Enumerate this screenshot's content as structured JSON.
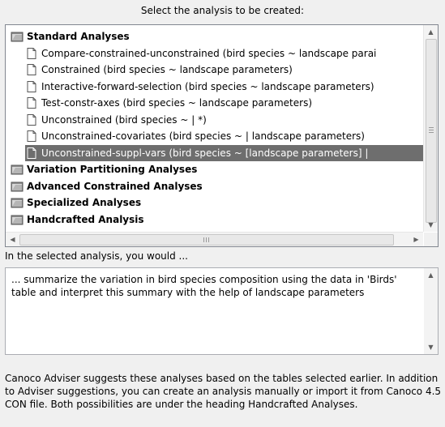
{
  "prompt": "Select the analysis to be created:",
  "tree": [
    {
      "kind": "category",
      "label": "Standard Analyses"
    },
    {
      "kind": "item",
      "label": "Compare-constrained-unconstrained (bird species ~ landscape parai"
    },
    {
      "kind": "item",
      "label": "Constrained (bird species ~ landscape parameters)"
    },
    {
      "kind": "item",
      "label": "Interactive-forward-selection (bird species ~ landscape parameters)"
    },
    {
      "kind": "item",
      "label": "Test-constr-axes (bird species ~ landscape parameters)"
    },
    {
      "kind": "item",
      "label": "Unconstrained (bird species ~ | *)"
    },
    {
      "kind": "item",
      "label": "Unconstrained-covariates (bird species ~ | landscape parameters)"
    },
    {
      "kind": "item",
      "label": "Unconstrained-suppl-vars (bird species ~ [landscape parameters] |",
      "selected": true
    },
    {
      "kind": "category",
      "label": "Variation Partitioning Analyses"
    },
    {
      "kind": "category",
      "label": "Advanced Constrained Analyses"
    },
    {
      "kind": "category",
      "label": "Specialized Analyses"
    },
    {
      "kind": "category",
      "label": "Handcrafted Analysis"
    }
  ],
  "selected_heading": "In the selected analysis, you would ...",
  "description": "... summarize the variation in bird species composition using the data in 'Birds' table and interpret this summary with the help of landscape parameters",
  "footer": "Canoco Adviser suggests these analyses based on the tables selected earlier. In addition to Adviser suggestions, you can create an analysis manually or import it from Canoco 4.5 CON file. Both possibilities are under the heading Handcrafted Analyses.",
  "colors": {
    "selection": "#6e6e6e",
    "folder": "#8c8c8c"
  },
  "icons": {
    "category": "folder-icon",
    "item": "document-icon"
  }
}
